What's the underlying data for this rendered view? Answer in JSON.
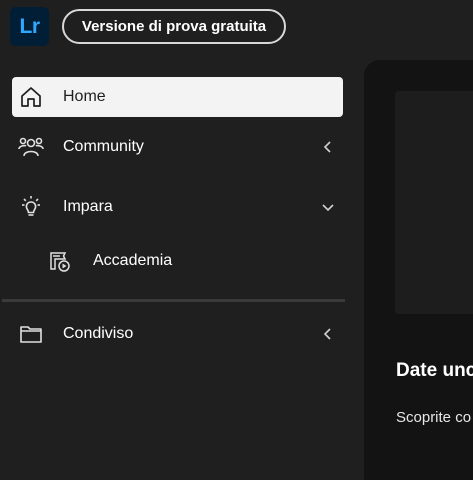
{
  "app": {
    "logo_text": "Lr",
    "logo_bg": "#001e36",
    "logo_fg": "#31a8ff"
  },
  "header": {
    "trial_button_label": "Versione di prova gratuita"
  },
  "sidebar": {
    "items": [
      {
        "label": "Home",
        "icon": "home-icon",
        "active": true
      },
      {
        "label": "Community",
        "icon": "community-icon",
        "chevron": "chevron-left-icon"
      },
      {
        "label": "Impara",
        "icon": "lightbulb-icon",
        "chevron": "chevron-down-icon"
      },
      {
        "label": "Accademia",
        "icon": "academy-icon"
      },
      {
        "label": "Condiviso",
        "icon": "folder-icon",
        "chevron": "chevron-left-icon"
      }
    ]
  },
  "main": {
    "heading": "Date unc",
    "text": "Scoprite co"
  }
}
